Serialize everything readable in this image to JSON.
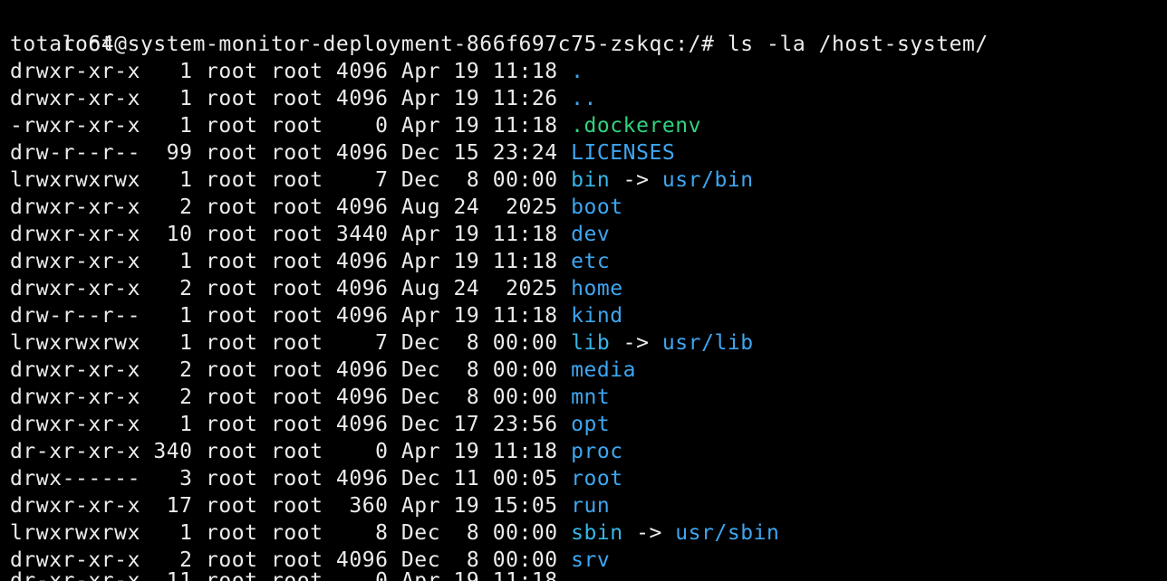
{
  "terminal": {
    "prompt": "root@system-monitor-deployment-866f697c75-zskqc:/# ",
    "command": "ls -la /host-system/",
    "total": "total 64",
    "arrow": " -> ",
    "entries": [
      {
        "meta": "drwxr-xr-x   1 root root 4096 Apr 19 11:18 ",
        "name": ".",
        "kind": "dir",
        "target": ""
      },
      {
        "meta": "drwxr-xr-x   1 root root 4096 Apr 19 11:26 ",
        "name": "..",
        "kind": "dir",
        "target": ""
      },
      {
        "meta": "-rwxr-xr-x   1 root root    0 Apr 19 11:18 ",
        "name": ".dockerenv",
        "kind": "file",
        "target": ""
      },
      {
        "meta": "drw-r--r--  99 root root 4096 Dec 15 23:24 ",
        "name": "LICENSES",
        "kind": "dir",
        "target": ""
      },
      {
        "meta": "lrwxrwxrwx   1 root root    7 Dec  8 00:00 ",
        "name": "bin",
        "kind": "link",
        "target": "usr/bin"
      },
      {
        "meta": "drwxr-xr-x   2 root root 4096 Aug 24  2025 ",
        "name": "boot",
        "kind": "dir",
        "target": ""
      },
      {
        "meta": "drwxr-xr-x  10 root root 3440 Apr 19 11:18 ",
        "name": "dev",
        "kind": "dir",
        "target": ""
      },
      {
        "meta": "drwxr-xr-x   1 root root 4096 Apr 19 11:18 ",
        "name": "etc",
        "kind": "dir",
        "target": ""
      },
      {
        "meta": "drwxr-xr-x   2 root root 4096 Aug 24  2025 ",
        "name": "home",
        "kind": "dir",
        "target": ""
      },
      {
        "meta": "drw-r--r--   1 root root 4096 Apr 19 11:18 ",
        "name": "kind",
        "kind": "dir",
        "target": ""
      },
      {
        "meta": "lrwxrwxrwx   1 root root    7 Dec  8 00:00 ",
        "name": "lib",
        "kind": "link",
        "target": "usr/lib"
      },
      {
        "meta": "drwxr-xr-x   2 root root 4096 Dec  8 00:00 ",
        "name": "media",
        "kind": "dir",
        "target": ""
      },
      {
        "meta": "drwxr-xr-x   2 root root 4096 Dec  8 00:00 ",
        "name": "mnt",
        "kind": "dir",
        "target": ""
      },
      {
        "meta": "drwxr-xr-x   1 root root 4096 Dec 17 23:56 ",
        "name": "opt",
        "kind": "dir",
        "target": ""
      },
      {
        "meta": "dr-xr-xr-x 340 root root    0 Apr 19 11:18 ",
        "name": "proc",
        "kind": "dir",
        "target": ""
      },
      {
        "meta": "drwx------   3 root root 4096 Dec 11 00:05 ",
        "name": "root",
        "kind": "dir",
        "target": ""
      },
      {
        "meta": "drwxr-xr-x  17 root root  360 Apr 19 15:05 ",
        "name": "run",
        "kind": "dir",
        "target": ""
      },
      {
        "meta": "lrwxrwxrwx   1 root root    8 Dec  8 00:00 ",
        "name": "sbin",
        "kind": "link",
        "target": "usr/sbin"
      },
      {
        "meta": "drwxr-xr-x   2 root root 4096 Dec  8 00:00 ",
        "name": "srv",
        "kind": "dir",
        "target": ""
      }
    ],
    "partial_last_line": "dr-xr-xr-x  11 root root    0 Apr 19 11:18 ",
    "colors": {
      "background": "#000000",
      "text": "#ececec",
      "directory": "#3ea6f0",
      "file": "#2fd37f",
      "symlink": "#38b6e8"
    }
  }
}
